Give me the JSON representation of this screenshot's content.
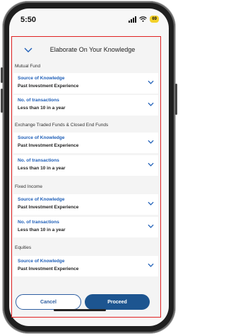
{
  "status_bar": {
    "time": "5:50",
    "battery": "69"
  },
  "sheet": {
    "title": "Elaborate On Your Knowledge",
    "sections": [
      {
        "label": "Mutual Fund",
        "fields": [
          {
            "label": "Source of Knowledge",
            "value": "Past Investment Experience"
          },
          {
            "label": "No. of transactions",
            "value": "Less than 10 in a year"
          }
        ]
      },
      {
        "label": "Exchange Traded Funds & Closed End Funds",
        "fields": [
          {
            "label": "Source of Knowledge",
            "value": "Past Investment Experience"
          },
          {
            "label": "No. of transactions",
            "value": "Less than 10 in a year"
          }
        ]
      },
      {
        "label": "Fixed Income",
        "fields": [
          {
            "label": "Source of Knowledge",
            "value": "Past Investment Experience"
          },
          {
            "label": "No. of transactions",
            "value": "Less than 10 in a year"
          }
        ]
      },
      {
        "label": "Equities",
        "fields": [
          {
            "label": "Source of Knowledge",
            "value": "Past Investment Experience"
          }
        ]
      }
    ]
  },
  "buttons": {
    "cancel": "Cancel",
    "proceed": "Proceed"
  },
  "colors": {
    "accent": "#1f5fb8",
    "primary_button": "#1d5590",
    "highlight_border": "#e02222"
  }
}
